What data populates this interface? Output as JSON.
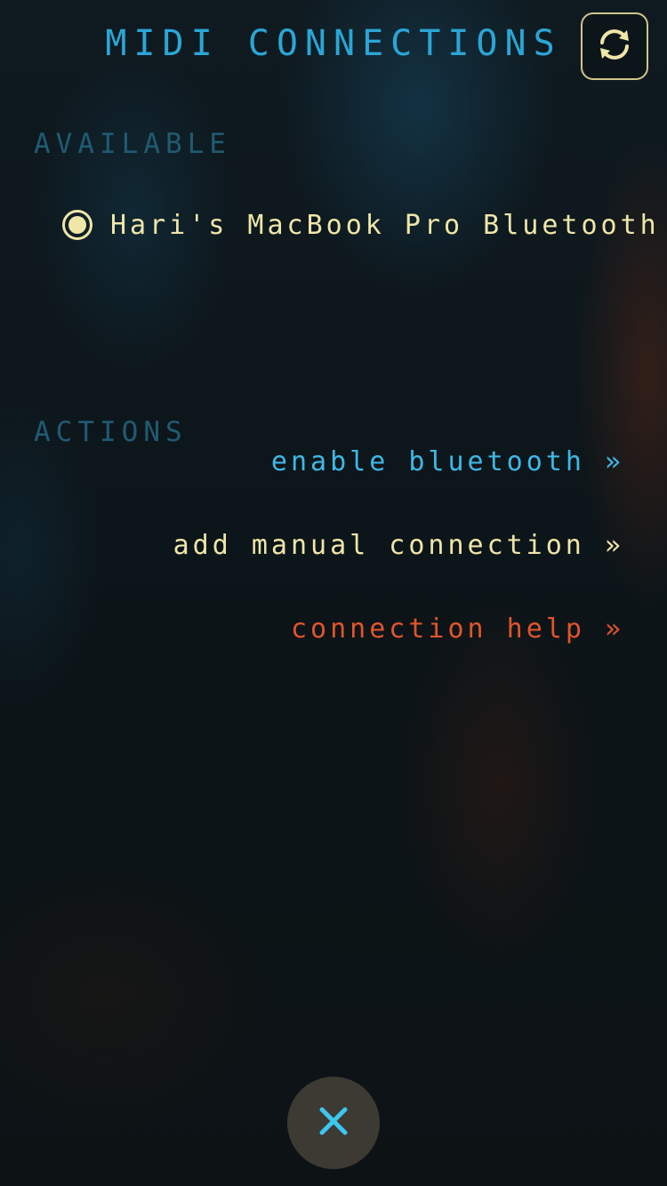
{
  "header": {
    "title": "MIDI CONNECTIONS",
    "refresh_icon": "refresh-icon"
  },
  "available": {
    "label": "AVAILABLE",
    "devices": [
      {
        "name": "Hari's MacBook Pro Bluetooth",
        "selected": true
      }
    ]
  },
  "actions": {
    "label": "ACTIONS",
    "items": [
      {
        "label": "enable bluetooth »",
        "color": "#3cb9e8"
      },
      {
        "label": "add manual connection »",
        "color": "#efe6a8"
      },
      {
        "label": "connection help »",
        "color": "#e0552a"
      }
    ]
  },
  "footer": {
    "close_icon": "close-icon"
  },
  "colors": {
    "title": "#2aa6d6",
    "section_label": "#1f5b72",
    "accent_cream": "#efe6a8",
    "close_x": "#3cc6f0"
  }
}
